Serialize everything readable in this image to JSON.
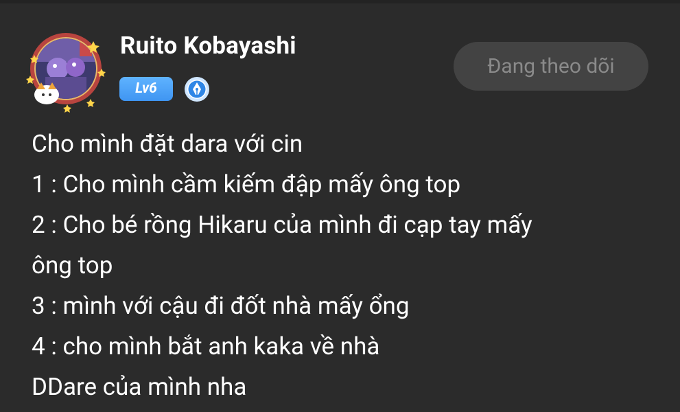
{
  "user": {
    "name": "Ruito Kobayashi",
    "level": "Lv6",
    "avatar_icon": "anime-character-avatar-icon",
    "role_icon": "fountain-pen-icon"
  },
  "follow_button": {
    "label": "Đang theo dõi"
  },
  "post": {
    "lines": [
      "Cho mình đặt dara với cin",
      "1 : Cho mình cầm kiếm đập mấy ông top",
      "2 : Cho bé rồng Hikaru của mình đi cạp tay mấy",
      "ông top",
      "3 : mình với cậu đi đốt nhà mấy ổng",
      "4 : cho mình bắt anh kaka về nhà",
      "DDare của mình nha"
    ]
  },
  "colors": {
    "background": "#2b2b2b",
    "text": "#ffffff",
    "level_badge": "#4aa3f8",
    "button_bg": "#434343",
    "button_text": "#8a8a8a"
  }
}
